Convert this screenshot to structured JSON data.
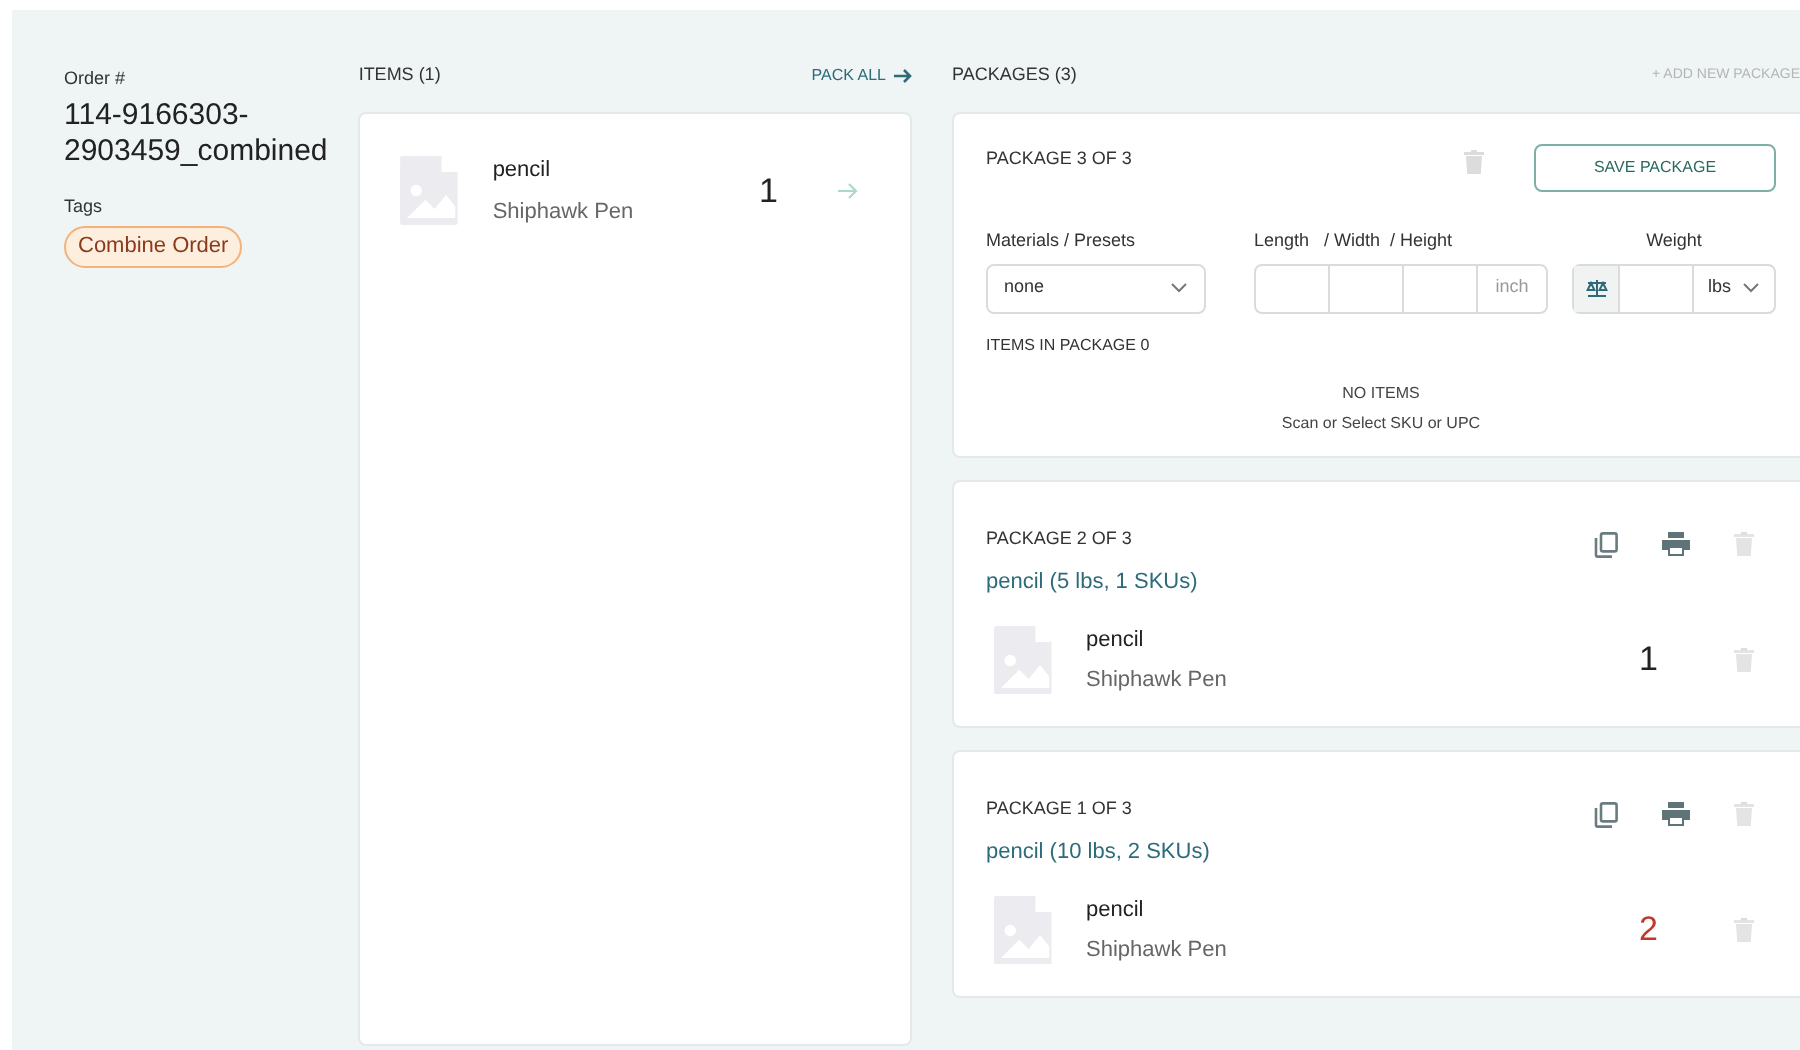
{
  "order": {
    "label": "Order #",
    "number": "114-9166303-2903459_combined",
    "tags_label": "Tags",
    "tags": [
      "Combine Order"
    ]
  },
  "items": {
    "title": "ITEMS (1)",
    "pack_all": "PACK ALL",
    "list": [
      {
        "name": "pencil",
        "sku": "Shiphawk Pen",
        "quantity": "1"
      }
    ]
  },
  "packages": {
    "title": "PACKAGES (3)",
    "add": "+ ADD NEW PACKAGE",
    "editing": {
      "title": "PACKAGE 3 OF 3",
      "save": "SAVE PACKAGE",
      "materials_label": "Materials / Presets",
      "material": "none",
      "dims_label": "Length   / Width  / Height",
      "dim_unit": "inch",
      "weight_label": "Weight",
      "weight_unit": "lbs",
      "items_label": "ITEMS IN PACKAGE 0",
      "empty_title": "NO ITEMS",
      "empty_hint": "Scan or Select SKU or UPC"
    },
    "saved": [
      {
        "title": "PACKAGE 2 OF 3",
        "summary": "pencil (5 lbs, 1 SKUs)",
        "items": [
          {
            "name": "pencil",
            "sku": "Shiphawk Pen",
            "quantity": "1",
            "alert": false
          }
        ]
      },
      {
        "title": "PACKAGE 1 OF 3",
        "summary": "pencil (10 lbs, 2 SKUs)",
        "items": [
          {
            "name": "pencil",
            "sku": "Shiphawk Pen",
            "quantity": "2",
            "alert": true
          }
        ]
      }
    ]
  }
}
